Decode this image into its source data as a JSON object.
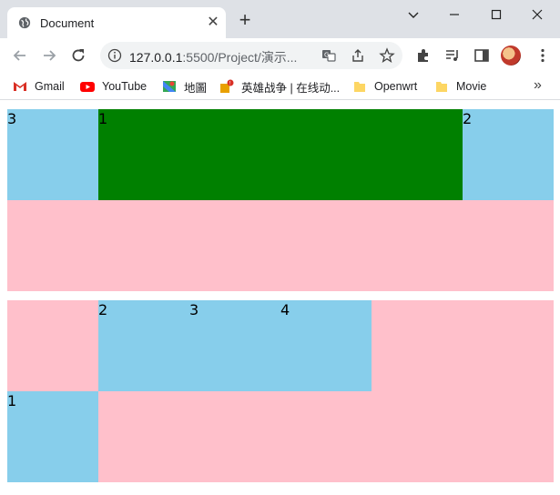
{
  "tab": {
    "title": "Document",
    "close_glyph": "✕"
  },
  "new_tab_glyph": "+",
  "address": {
    "host": "127.0.0.1",
    "rest": ":5500/Project/演示..."
  },
  "bookmarks": [
    {
      "label": "Gmail",
      "icon": "gmail-icon"
    },
    {
      "label": "YouTube",
      "icon": "youtube-icon"
    },
    {
      "label": "地圖",
      "icon": "maps-icon"
    },
    {
      "label": "英雄战争 | 在线动...",
      "icon": "game-icon"
    },
    {
      "label": "Openwrt",
      "icon": "folder-icon"
    },
    {
      "label": "Movie",
      "icon": "folder-icon"
    }
  ],
  "bookmarks_more": "»",
  "content": {
    "grid1": {
      "cell_left": "3",
      "cell_center": "1",
      "cell_right": "2"
    },
    "grid2": {
      "cell_a": "2",
      "cell_b": "3",
      "cell_c": "4",
      "cell_d": "1"
    }
  },
  "colors": {
    "pink": "#ffc0cb",
    "skyblue": "#87ceeb",
    "green": "#008000",
    "chrome_bg": "#dee1e6"
  }
}
